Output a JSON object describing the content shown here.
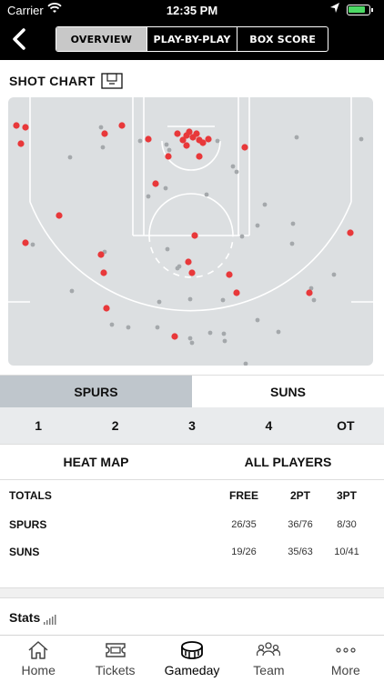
{
  "status_bar": {
    "carrier": "Carrier",
    "time": "12:35 PM"
  },
  "header": {
    "tabs": [
      {
        "label": "OVERVIEW",
        "active": true
      },
      {
        "label": "PLAY-BY-PLAY",
        "active": false
      },
      {
        "label": "BOX SCORE",
        "active": false
      }
    ]
  },
  "shot_chart": {
    "title": "SHOT CHART",
    "colors": {
      "made": "#e8383a",
      "missed": "#a4a8ab",
      "court": "#dcdfe1",
      "lines": "#ffffff"
    }
  },
  "team_tabs": [
    {
      "label": "SPURS",
      "active": true
    },
    {
      "label": "SUNS",
      "active": false
    }
  ],
  "periods": [
    "1",
    "2",
    "3",
    "4",
    "OT"
  ],
  "options": {
    "heat_map": "HEAT MAP",
    "players": "ALL PLAYERS"
  },
  "totals": {
    "headers": [
      "TOTALS",
      "FREE",
      "2PT",
      "3PT"
    ],
    "rows": [
      {
        "team": "SPURS",
        "free": "26/35",
        "two": "36/76",
        "three": "8/30"
      },
      {
        "team": "SUNS",
        "free": "19/26",
        "two": "35/63",
        "three": "10/41"
      }
    ]
  },
  "stats": {
    "label": "Stats"
  },
  "bottom_nav": [
    {
      "label": "Home",
      "icon": "home-icon",
      "active": false
    },
    {
      "label": "Tickets",
      "icon": "ticket-icon",
      "active": false
    },
    {
      "label": "Gameday",
      "icon": "gameday-icon",
      "active": true
    },
    {
      "label": "Team",
      "icon": "team-icon",
      "active": false
    },
    {
      "label": "More",
      "icon": "more-icon",
      "active": false
    }
  ]
}
